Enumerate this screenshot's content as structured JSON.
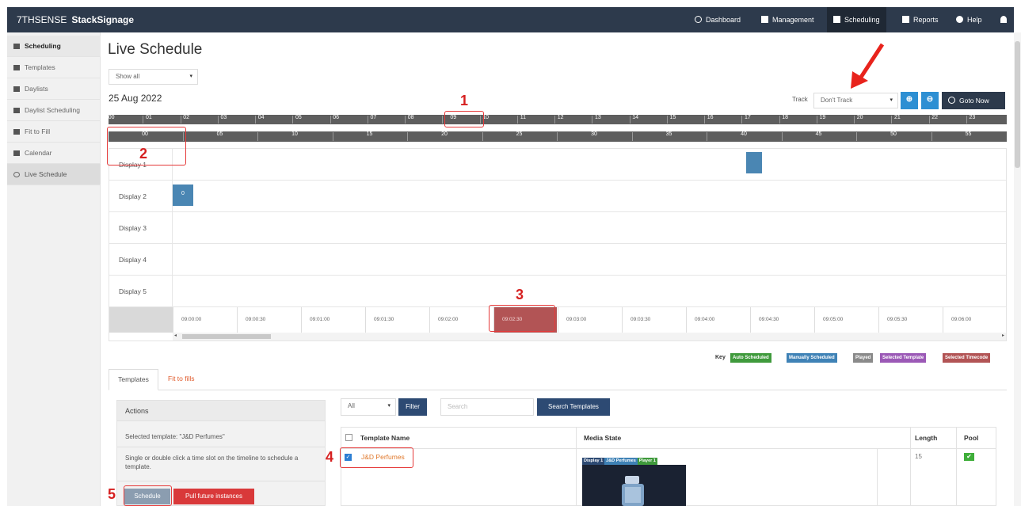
{
  "brand": {
    "left": "7THSENSE",
    "right": "StackSignage"
  },
  "topnav": {
    "items": [
      {
        "label": "Dashboard",
        "icon": "clock-icon"
      },
      {
        "label": "Management",
        "icon": "briefcase-icon"
      },
      {
        "label": "Scheduling",
        "icon": "calendar-icon"
      },
      {
        "label": "Reports",
        "icon": "table-icon"
      },
      {
        "label": "Help",
        "icon": "info-icon"
      },
      {
        "label": "",
        "icon": "user-icon"
      }
    ]
  },
  "sidebar": {
    "items": [
      {
        "label": "Scheduling"
      },
      {
        "label": "Templates"
      },
      {
        "label": "Daylists"
      },
      {
        "label": "Daylist Scheduling"
      },
      {
        "label": "Fit to Fill"
      },
      {
        "label": "Calendar"
      },
      {
        "label": "Live Schedule"
      }
    ]
  },
  "main": {
    "title": "Live Schedule",
    "filter_select": "Show all",
    "date": "25 Aug 2022",
    "track_label": "Track",
    "track_select": "Don't Track",
    "zoom_in": "⊕",
    "zoom_out": "⊖",
    "goto_now": "Goto Now"
  },
  "hours": [
    "00",
    "01",
    "02",
    "03",
    "04",
    "05",
    "06",
    "07",
    "08",
    "09",
    "10",
    "11",
    "12",
    "13",
    "14",
    "15",
    "16",
    "17",
    "18",
    "19",
    "20",
    "21",
    "22",
    "23"
  ],
  "minutes": [
    "00",
    "05",
    "10",
    "15",
    "20",
    "25",
    "30",
    "35",
    "40",
    "45",
    "50",
    "55"
  ],
  "displays": [
    "Display 1",
    "Display 2",
    "Display 3",
    "Display 4",
    "Display 5"
  ],
  "display2_block": "0",
  "times": [
    "09:00:00",
    "09:00:30",
    "09:01:00",
    "09:01:30",
    "09:02:00",
    "09:02:30",
    "09:03:00",
    "09:03:30",
    "09:04:00",
    "09:04:30",
    "09:05:00",
    "09:05:30",
    "09:06:00"
  ],
  "key": {
    "label": "Key",
    "items": [
      {
        "label": "Auto Scheduled",
        "color": "#3f9a3c"
      },
      {
        "label": "Manually Scheduled",
        "color": "#3f82b6"
      },
      {
        "label": "Played",
        "color": "#8a8a8a"
      },
      {
        "label": "Selected Template",
        "color": "#9b59b6"
      },
      {
        "label": "Selected Timecode",
        "color": "#b25455"
      }
    ]
  },
  "tabs": {
    "templates": "Templates",
    "fit": "Fit to fills"
  },
  "actions": {
    "title": "Actions",
    "selected": "Selected template: \"J&D Perfumes\"",
    "hint": "Single or double click a time slot on the timeline to schedule a template.",
    "schedule": "Schedule",
    "pull": "Pull future instances"
  },
  "table_controls": {
    "filter_select": "All",
    "filter_btn": "Filter",
    "search_placeholder": "Search",
    "search_btn": "Search Templates"
  },
  "table": {
    "headers": {
      "name": "Template Name",
      "media": "Media State",
      "length": "Length",
      "pool": "Pool"
    },
    "row": {
      "name": "J&D Perfumes",
      "length": "15",
      "badges": [
        {
          "label": "Display 1",
          "color": "#2d4a73"
        },
        {
          "label": "J&D Perfumes",
          "color": "#3f82b6"
        },
        {
          "label": "Player 1",
          "color": "#3f9a3c"
        }
      ]
    }
  },
  "annotations": [
    "1",
    "2",
    "3",
    "4",
    "5"
  ],
  "colors": {
    "nav": "#2d3a4c",
    "accent": "#2d8fd3",
    "selected": "#b25455",
    "block": "#4a86b3",
    "annotation": "#e53a3a"
  }
}
